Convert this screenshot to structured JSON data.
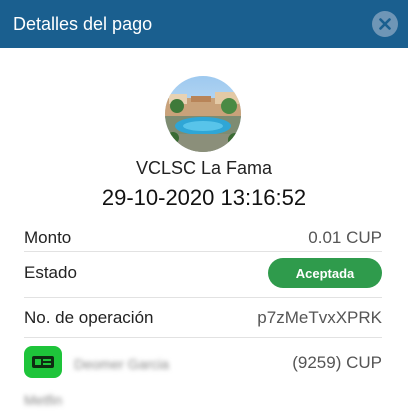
{
  "header": {
    "title": "Detalles del pago"
  },
  "merchant": {
    "name": "VCLSC La Fama",
    "datetime": "29-10-2020 13:16:52"
  },
  "details": {
    "amount_label": "Monto",
    "amount_value": "0.01 CUP",
    "status_label": "Estado",
    "status_value": "Aceptada",
    "operation_label": "No. de operación",
    "operation_value": "p7zMeTvxXPRK"
  },
  "card": {
    "holder_name": "Deomer Garcia",
    "bank_name": "Metfin",
    "card_value": "(9259) CUP"
  },
  "colors": {
    "header": "#1a5f8f",
    "status_badge": "#2f9b4c",
    "bank_logo": "#1ec43a"
  },
  "icons": {
    "close": "close-icon",
    "bank": "bank-logo-icon"
  }
}
